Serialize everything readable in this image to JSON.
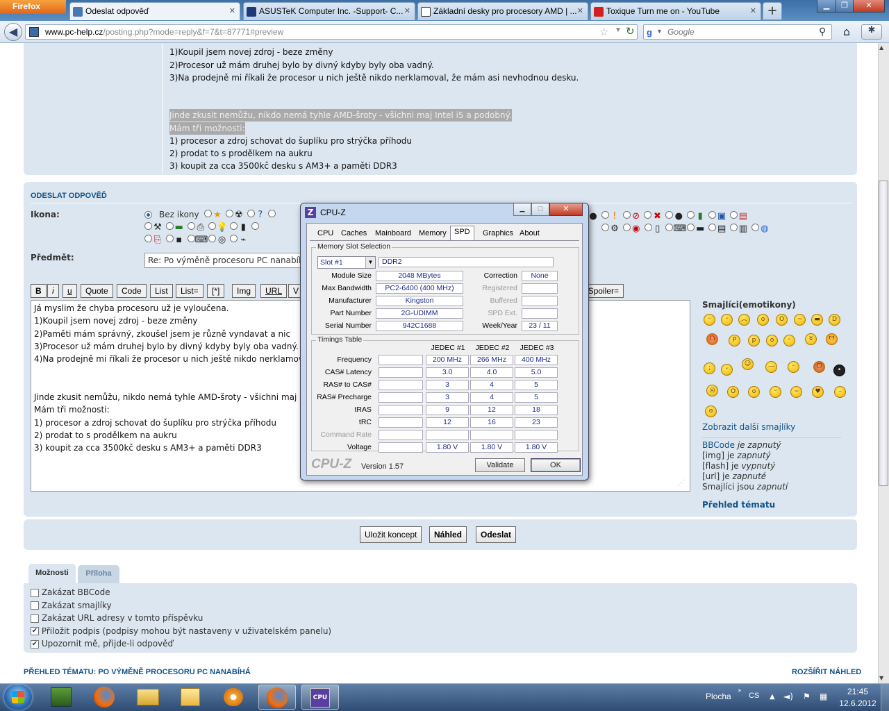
{
  "browser": {
    "app_button": "Firefox",
    "tabs": [
      {
        "label": "Odeslat odpověď",
        "active": true
      },
      {
        "label": "ASUSTeK Computer Inc. -Support- C..."
      },
      {
        "label": "Základní desky pro procesory AMD | ..."
      },
      {
        "label": "Toxique Turn me on - YouTube"
      }
    ],
    "url_domain": "www.pc-help.cz",
    "url_path": "/posting.php?mode=reply&f=7&t=87771#preview",
    "search_placeholder": "Google"
  },
  "preview": {
    "lines": [
      "1)Koupil jsem novej zdroj - beze změny",
      "2)Procesor už mám druhej bylo by divný kdyby byly oba vadný.",
      "3)Na prodejně mi říkali že procesor u nich ještě nikdo nerklamoval, že mám asi nevhodnou desku."
    ],
    "hl1": "Jinde zkusit nemůžu, nikdo nemá tyhle AMD-šroty - všichni maj  Intel i5 a podobný.",
    "hl2": "Mám tři možnosti:",
    "options": [
      "1) procesor a zdroj schovat do šuplíku pro strýčka příhodu",
      "2) prodat to s prodělkem na aukru",
      "3) koupit za cca 3500kč desku s AM3+ a paměti DDR3"
    ]
  },
  "form": {
    "section_title": "ODESLAT ODPOVĚĎ",
    "icon_label": "Ikona:",
    "no_icon": "Bez ikony",
    "subject_label": "Předmět:",
    "subject_value": "Re: Po výměně procesoru PC nanabíhá",
    "format_buttons": [
      "B",
      "i",
      "u",
      "Quote",
      "Code",
      "List",
      "List=",
      "[*]",
      "Img",
      "URL",
      "V"
    ],
    "spoiler_button": "Spoiler=",
    "message": "Já myslim že chyba procesoru už je vyloučena.\n1)Koupil jsem novej zdroj - beze změny\n2)Paměti mám správný, zkoušel jsem je různě vyndavat a nic\n3)Procesor už mám druhej bylo by divný kdyby byly oba vadný.\n4)Na prodejně mi říkali že procesor u nich ještě nikdo nerklamoval\n\n\nJinde zkusit nemůžu, nikdo nemá tyhle AMD-šroty - všichni maj  Intel i5 a podobný.\nMám tři možnosti:\n1) procesor a zdroj schovat do šuplíku pro strýčka příhodu\n2) prodat to s prodělkem na aukru\n3) koupit za cca 3500kč desku s AM3+ a paměti DDR3"
  },
  "sidebar": {
    "smilies_title": "Smajlíci(emotikony)",
    "more_smilies": "Zobrazit další smajlíky",
    "bbcode": "BBCode",
    "bbcode_state": "je zapnutý",
    "img": "[img] je",
    "img_state": "zapnutý",
    "flash": "[flash] je",
    "flash_state": "vypnutý",
    "url": "[url] je",
    "url_state": "zapnuté",
    "smilies": "Smajlíci jsou",
    "smilies_state": "zapnutí",
    "topic_review": "Přehled tématu"
  },
  "actions": {
    "save_draft": "Uložit koncept",
    "preview": "Náhled",
    "submit": "Odeslat"
  },
  "options_tabs": [
    "Možnosti",
    "Příloha"
  ],
  "options": [
    {
      "label": "Zakázat BBCode",
      "checked": false
    },
    {
      "label": "Zakázat smajlíky",
      "checked": false
    },
    {
      "label": "Zakázat URL adresy v tomto příspěvku",
      "checked": false
    },
    {
      "label": "Přiložit podpis (podpisy mohou být nastaveny v uživatelském panelu)",
      "checked": true
    },
    {
      "label": "Upozornit mě, přijde-li odpověď",
      "checked": true
    }
  ],
  "footer": {
    "left": "PŘEHLED TÉMATU: PO VÝMĚNĚ PROCESORU PC NANABÍHÁ",
    "right": "ROZŠÍŘIT NÁHLED"
  },
  "cpuz": {
    "title": "CPU-Z",
    "tabs": [
      "CPU",
      "Caches",
      "Mainboard",
      "Memory",
      "SPD",
      "Graphics",
      "About"
    ],
    "active_tab": "SPD",
    "slot_group": "Memory Slot Selection",
    "slot": "Slot #1",
    "type": "DDR2",
    "module_size_l": "Module Size",
    "module_size": "2048 MBytes",
    "max_bw_l": "Max Bandwidth",
    "max_bw": "PC2-6400 (400 MHz)",
    "manufacturer_l": "Manufacturer",
    "manufacturer": "Kingston",
    "part_l": "Part Number",
    "part": "2G-UDIMM",
    "serial_l": "Serial Number",
    "serial": "942C1688",
    "correction_l": "Correction",
    "correction": "None",
    "registered_l": "Registered",
    "buffered_l": "Buffered",
    "spd_ext_l": "SPD Ext.",
    "week_year_l": "Week/Year",
    "week_year": "23 / 11",
    "timings_group": "Timings Table",
    "jedec": [
      "JEDEC #1",
      "JEDEC #2",
      "JEDEC #3"
    ],
    "rows": [
      {
        "label": "Frequency",
        "vals": [
          "200 MHz",
          "266 MHz",
          "400 MHz"
        ]
      },
      {
        "label": "CAS# Latency",
        "vals": [
          "3.0",
          "4.0",
          "5.0"
        ]
      },
      {
        "label": "RAS# to CAS#",
        "vals": [
          "3",
          "4",
          "5"
        ]
      },
      {
        "label": "RAS# Precharge",
        "vals": [
          "3",
          "4",
          "5"
        ]
      },
      {
        "label": "tRAS",
        "vals": [
          "9",
          "12",
          "18"
        ]
      },
      {
        "label": "tRC",
        "vals": [
          "12",
          "16",
          "23"
        ]
      },
      {
        "label": "Command Rate",
        "vals": [
          "",
          "",
          ""
        ],
        "dim": true
      },
      {
        "label": "Voltage",
        "vals": [
          "1.80 V",
          "1.80 V",
          "1.80 V"
        ]
      }
    ],
    "logo": "CPU-Z",
    "version": "Version 1.57",
    "validate": "Validate",
    "ok": "OK"
  },
  "taskbar": {
    "desktop": "Plocha",
    "lang": "CS",
    "time": "21:45",
    "date": "12.6.2012"
  }
}
